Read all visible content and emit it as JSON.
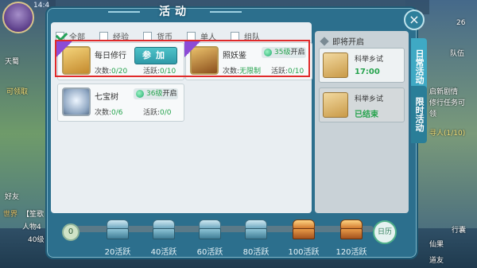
{
  "status": {
    "clock": "14:4"
  },
  "panel": {
    "title": "活动"
  },
  "filters": [
    {
      "label": "全部",
      "checked": true
    },
    {
      "label": "经验",
      "checked": false
    },
    {
      "label": "货币",
      "checked": false
    },
    {
      "label": "单人",
      "checked": false
    },
    {
      "label": "组队",
      "checked": false
    }
  ],
  "activities": [
    {
      "name": "每日修行",
      "count_label": "次数:",
      "count_value": "0/20",
      "active_label": "活跃:",
      "active_value": "0/10",
      "button": "参加"
    },
    {
      "name": "照妖鉴",
      "level": "35级",
      "level_suffix": "开启",
      "count_label": "次数:",
      "count_value": "无限制",
      "active_label": "活跃:",
      "active_value": "0/10"
    },
    {
      "name": "七宝树",
      "level": "36级",
      "level_suffix": "开启",
      "count_label": "次数:",
      "count_value": "0/6",
      "active_label": "活跃:",
      "active_value": "0/0"
    }
  ],
  "upcoming": {
    "heading": "即将开启",
    "items": [
      {
        "name": "科举乡试",
        "status": "17:00",
        "done": false
      },
      {
        "name": "科举乡试",
        "status": "已结束",
        "done": true
      }
    ]
  },
  "tabs": [
    {
      "label": "日常活动",
      "active": true
    },
    {
      "label": "限时活动",
      "active": false
    }
  ],
  "close_label": "×",
  "rewards": {
    "current": "0",
    "calendar_label": "日历",
    "chests": [
      {
        "label": "20活跃",
        "kind": "silver"
      },
      {
        "label": "40活跃",
        "kind": "silver"
      },
      {
        "label": "60活跃",
        "kind": "silver"
      },
      {
        "label": "80活跃",
        "kind": "silver"
      },
      {
        "label": "100活跃",
        "kind": "gold"
      },
      {
        "label": "120活跃",
        "kind": "gold"
      }
    ]
  },
  "background_text": {
    "left_1": "天蜀",
    "left_2": "可领取",
    "left_3": "好友",
    "left_4": "世界",
    "left_5": "【笙歌",
    "left_6": "人物4",
    "left_7": "40级",
    "right_1": "队伍",
    "right_2": "启新剧情",
    "right_3": "修行任务可",
    "right_4": "领",
    "right_5": "寻人(1/10)",
    "right_6": "仙果",
    "right_7": "行囊",
    "right_8": "道友",
    "right_9": "26"
  }
}
